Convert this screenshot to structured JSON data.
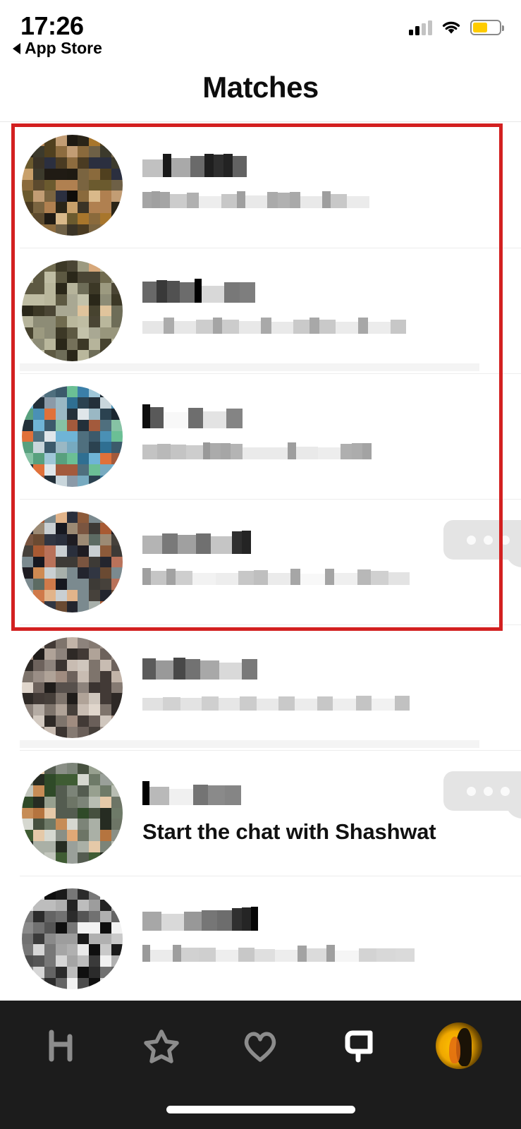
{
  "status_bar": {
    "time": "17:26",
    "back_label": "App Store",
    "signal_icon": "cellular-signal-icon",
    "signal_bars_filled": 2,
    "signal_bars_total": 4,
    "wifi_icon": "wifi-icon",
    "battery_icon": "battery-icon",
    "battery_percent": 55,
    "battery_color": "#ffcc00"
  },
  "nav": {
    "title": "Matches"
  },
  "annotation": {
    "name": "red-highlight-box",
    "color": "#d32020",
    "covers_rows": [
      1,
      2,
      3,
      4
    ]
  },
  "matches": [
    {
      "index": 1,
      "name_censored": true,
      "name": "",
      "subtitle": "",
      "avatar_name": "match-avatar-1",
      "avatar_censored": true,
      "avatar_palette": [
        "#8a6a3c",
        "#d9b98a",
        "#c8a06a",
        "#6b5a2e",
        "#3a3326",
        "#1e1a12",
        "#2b2f3f",
        "#50401f",
        "#a8762c",
        "#5c4a2e",
        "#201b14",
        "#7a6440",
        "#8d6c3f",
        "#c29d74",
        "#3c3a2c",
        "#0f0d0a",
        "#4a3b22",
        "#6e6046",
        "#b08050",
        "#2a2518"
      ],
      "typing_bubble": false,
      "unread_band": false
    },
    {
      "index": 2,
      "name_censored": true,
      "name": "",
      "subtitle": "",
      "avatar_name": "match-avatar-2",
      "avatar_censored": true,
      "avatar_palette": [
        "#a9a893",
        "#8d8c76",
        "#6e6d58",
        "#c3c2aa",
        "#b6b49b",
        "#d7a87a",
        "#4a4534",
        "#2a2719",
        "#847f63",
        "#9c9a80",
        "#b9b79c",
        "#706b4f",
        "#3c3826",
        "#e0c49c",
        "#5d5942",
        "#cfcdb4",
        "#98967c",
        "#47432f",
        "#bfbda3",
        "#75715a"
      ],
      "typing_bubble": false,
      "unread_band": true
    },
    {
      "index": 3,
      "name_censored": true,
      "name": "",
      "subtitle": "",
      "avatar_name": "match-avatar-3",
      "avatar_censored": true,
      "avatar_palette": [
        "#3b7fa8",
        "#2f6f92",
        "#6fb4d6",
        "#9fc7d8",
        "#4a90b5",
        "#77aac0",
        "#58a07e",
        "#6bbf95",
        "#c9d6dc",
        "#dfe6ea",
        "#8b9aa8",
        "#3c5a6b",
        "#2b4250",
        "#e0713a",
        "#a35a3c",
        "#23303a",
        "#4f6f7e",
        "#9ab8c4",
        "#86c2a4",
        "#1b2630"
      ],
      "typing_bubble": false,
      "unread_band": false
    },
    {
      "index": 4,
      "name_censored": true,
      "name": "",
      "subtitle": "",
      "avatar_name": "match-avatar-4",
      "avatar_censored": true,
      "avatar_palette": [
        "#7b8a8f",
        "#c9cfd2",
        "#a8b0ab",
        "#5c6b63",
        "#3d3a36",
        "#d07a4a",
        "#a85a33",
        "#1e1c22",
        "#2a2f3c",
        "#e2b48a",
        "#8c5a3a",
        "#46413b",
        "#b9725a",
        "#6a4a32",
        "#23252e",
        "#9c8a74",
        "#cf8a52",
        "#313642",
        "#7a5540",
        "#161820"
      ],
      "typing_bubble": true,
      "unread_band": false
    },
    {
      "index": 5,
      "name_censored": true,
      "name": "",
      "subtitle": "",
      "avatar_name": "match-avatar-5",
      "avatar_censored": true,
      "avatar_palette": [
        "#b5aca4",
        "#8d837c",
        "#cfc6bd",
        "#6d625c",
        "#423a36",
        "#a08c80",
        "#e0d6cc",
        "#57504c",
        "#7e746c",
        "#2e2926",
        "#c2b4a8",
        "#9a8e86",
        "#463f3a",
        "#b0a398",
        "#6a5f59",
        "#1f1c1a",
        "#d3cac1",
        "#857a72",
        "#3b3431",
        "#c8bcb2"
      ],
      "typing_bubble": false,
      "unread_band": true
    },
    {
      "index": 6,
      "name_censored": true,
      "name": "",
      "subtitle": "Start the chat with Shashwat",
      "subtitle_plain": true,
      "match_person_name": "Shashwat",
      "avatar_name": "match-avatar-6",
      "avatar_censored": true,
      "avatar_palette": [
        "#9aa09a",
        "#c2c6bd",
        "#6e7a68",
        "#3f5c33",
        "#2f4a28",
        "#e0a876",
        "#b5743f",
        "#8a8f86",
        "#aab0a6",
        "#545c50",
        "#d6d8d0",
        "#7c8478",
        "#46503f",
        "#c68c56",
        "#97a08f",
        "#262c22",
        "#b8bdb2",
        "#6d7566",
        "#e5c9a8",
        "#39402f"
      ],
      "typing_bubble": true,
      "unread_band": false
    },
    {
      "index": 7,
      "name_censored": true,
      "name": "",
      "subtitle": "",
      "avatar_name": "match-avatar-7",
      "avatar_censored": true,
      "avatar_palette": [
        "#d6d6d6",
        "#8a8a8a",
        "#2b2b2b",
        "#f2f2f2",
        "#4d4d4d",
        "#b0b0b0",
        "#1a1a1a",
        "#c9c9c9",
        "#646464",
        "#eaeaea",
        "#3a3a3a",
        "#9d9d9d",
        "#777777",
        "#0f0f0f",
        "#e0e0e0",
        "#555555",
        "#bdbdbd",
        "#242424",
        "#a5a5a5",
        "#717171"
      ],
      "typing_bubble": false,
      "unread_band": false
    }
  ],
  "tab_bar": {
    "background": "#1c1c1c",
    "items": [
      {
        "name": "tab-discover",
        "icon": "hinge-logo-icon",
        "active": false
      },
      {
        "name": "tab-standouts",
        "icon": "star-icon",
        "active": false
      },
      {
        "name": "tab-likes-you",
        "icon": "heart-icon",
        "active": false
      },
      {
        "name": "tab-matches",
        "icon": "chat-bubble-icon",
        "active": true
      },
      {
        "name": "tab-profile",
        "icon": "profile-avatar-icon",
        "active": false
      }
    ],
    "home_indicator": "home-indicator"
  }
}
